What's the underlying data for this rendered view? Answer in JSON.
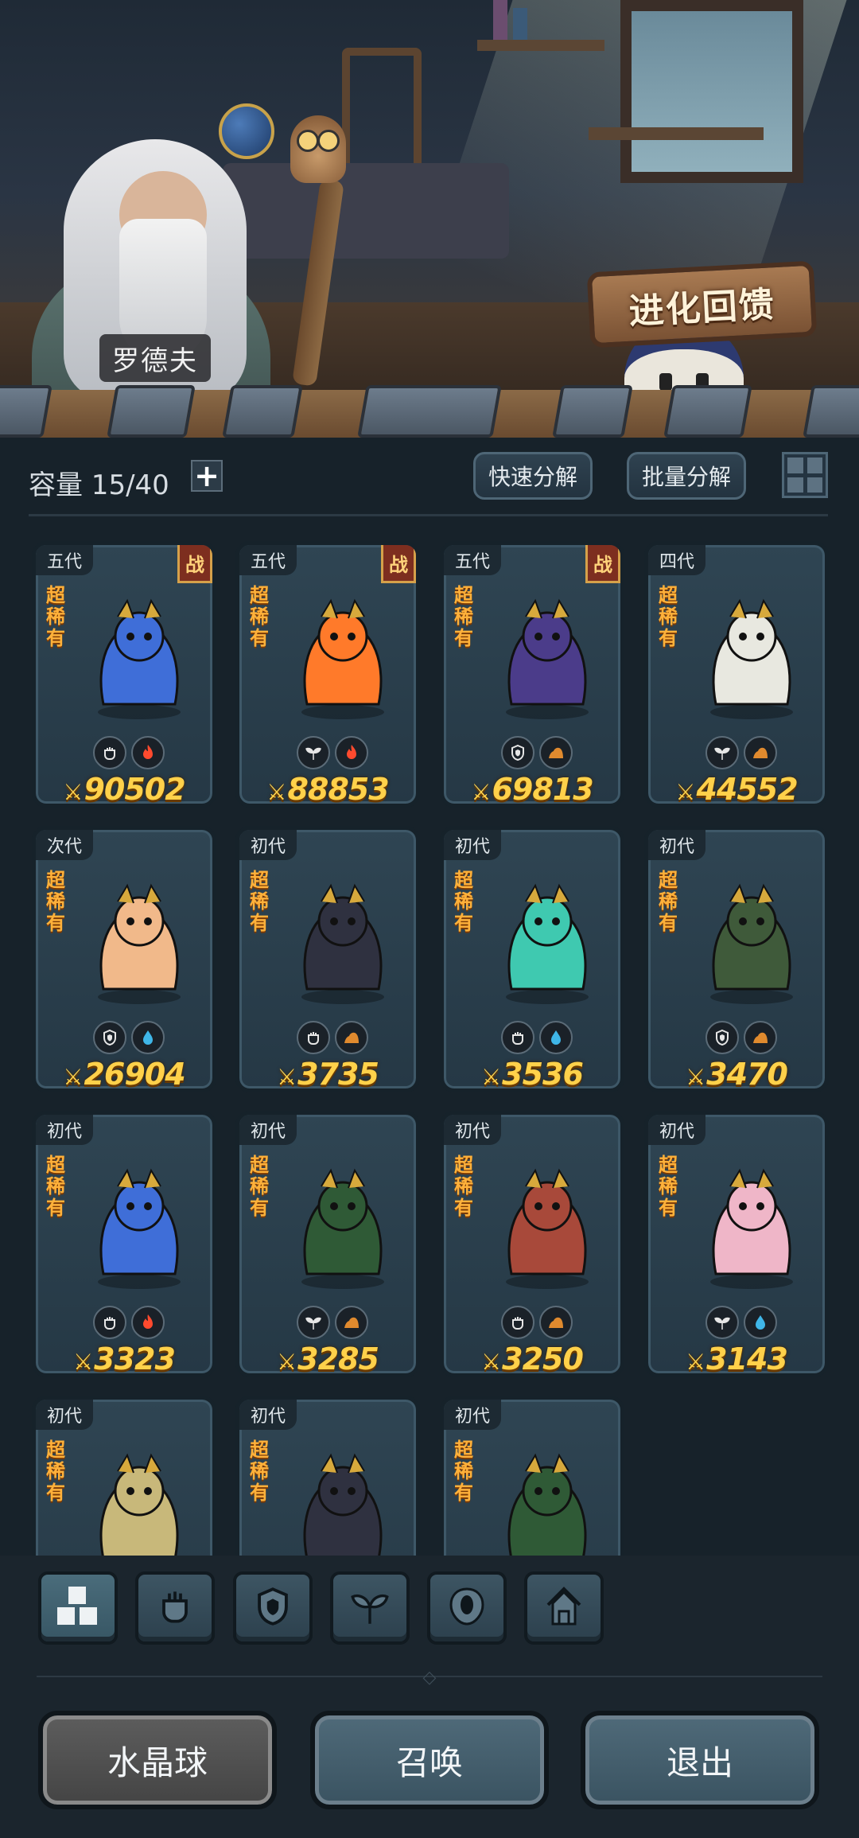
{
  "header": {
    "npc_name": "罗德夫",
    "event_button": "进化回馈"
  },
  "toolbar": {
    "capacity_label": "容量 15/40",
    "plus_symbol": "+",
    "quick_decompose": "快速分解",
    "batch_decompose": "批量分解"
  },
  "cards": [
    {
      "generation": "五代",
      "battle": "战",
      "rarity": "超稀有",
      "power": "90502",
      "elements": [
        "fist-icon",
        "fire-icon"
      ],
      "art_color": "#3f6ed8"
    },
    {
      "generation": "五代",
      "battle": "战",
      "rarity": "超稀有",
      "power": "88853",
      "elements": [
        "sprout-icon",
        "fire-icon"
      ],
      "art_color": "#ff7a2a"
    },
    {
      "generation": "五代",
      "battle": "战",
      "rarity": "超稀有",
      "power": "69813",
      "elements": [
        "shield-icon",
        "earth-icon"
      ],
      "art_color": "#4b3c8a"
    },
    {
      "generation": "四代",
      "battle": "",
      "rarity": "超稀有",
      "power": "44552",
      "elements": [
        "sprout-icon",
        "earth-icon"
      ],
      "art_color": "#e8e8e0"
    },
    {
      "generation": "次代",
      "battle": "",
      "rarity": "超稀有",
      "power": "26904",
      "elements": [
        "shield-icon",
        "water-icon"
      ],
      "art_color": "#f1b98a"
    },
    {
      "generation": "初代",
      "battle": "",
      "rarity": "超稀有",
      "power": "3735",
      "elements": [
        "fist-icon",
        "earth-icon"
      ],
      "art_color": "#2f3140"
    },
    {
      "generation": "初代",
      "battle": "",
      "rarity": "超稀有",
      "power": "3536",
      "elements": [
        "fist-icon",
        "water-icon"
      ],
      "art_color": "#3fc9b0"
    },
    {
      "generation": "初代",
      "battle": "",
      "rarity": "超稀有",
      "power": "3470",
      "elements": [
        "shield-icon",
        "earth-icon"
      ],
      "art_color": "#3f5a3a"
    },
    {
      "generation": "初代",
      "battle": "",
      "rarity": "超稀有",
      "power": "3323",
      "elements": [
        "fist-icon",
        "fire-icon"
      ],
      "art_color": "#3f6ed8"
    },
    {
      "generation": "初代",
      "battle": "",
      "rarity": "超稀有",
      "power": "3285",
      "elements": [
        "sprout-icon",
        "earth-icon"
      ],
      "art_color": "#2f5a36"
    },
    {
      "generation": "初代",
      "battle": "",
      "rarity": "超稀有",
      "power": "3250",
      "elements": [
        "fist-icon",
        "earth-icon"
      ],
      "art_color": "#a8493a"
    },
    {
      "generation": "初代",
      "battle": "",
      "rarity": "超稀有",
      "power": "3143",
      "elements": [
        "sprout-icon",
        "water-icon"
      ],
      "art_color": "#efb6c8"
    },
    {
      "generation": "初代",
      "battle": "",
      "rarity": "超稀有",
      "power": "",
      "elements": [],
      "art_color": "#c8b87a"
    },
    {
      "generation": "初代",
      "battle": "",
      "rarity": "超稀有",
      "power": "",
      "elements": [],
      "art_color": "#2f3140"
    },
    {
      "generation": "初代",
      "battle": "",
      "rarity": "超稀有",
      "power": "",
      "elements": [],
      "art_color": "#2f5a36"
    }
  ],
  "filter_tabs": [
    "all-icon",
    "fist-icon",
    "shield-icon",
    "sprout-icon",
    "alien-icon",
    "tower-icon"
  ],
  "bottom": {
    "crystal_ball": "水晶球",
    "summon": "召唤",
    "exit": "退出"
  }
}
